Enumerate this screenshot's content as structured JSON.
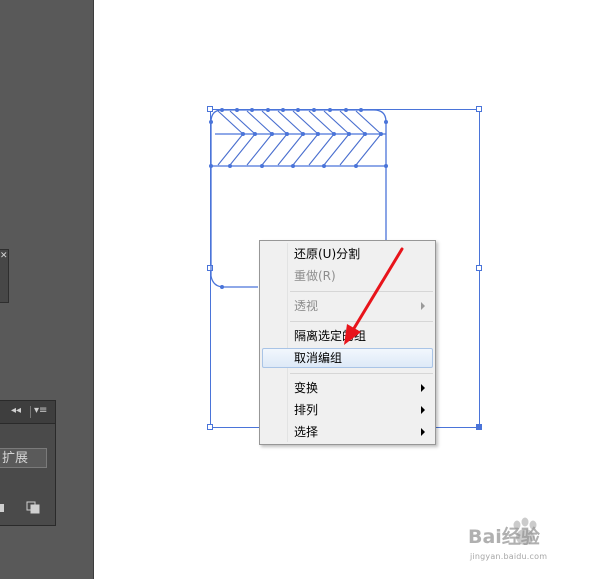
{
  "tool_panel": {
    "expand_button_label": "扩展"
  },
  "context_menu": {
    "items": [
      {
        "label": "还原(U)分割",
        "disabled": false,
        "submenu": false
      },
      {
        "label": "重做(R)",
        "disabled": true,
        "submenu": false
      },
      {
        "label": "透视",
        "disabled": true,
        "submenu": true
      },
      {
        "label": "隔离选定的组",
        "disabled": false,
        "submenu": false
      },
      {
        "label": "取消编组",
        "disabled": false,
        "submenu": false,
        "highlighted": true
      },
      {
        "label": "变换",
        "disabled": false,
        "submenu": true
      },
      {
        "label": "排列",
        "disabled": false,
        "submenu": true
      },
      {
        "label": "选择",
        "disabled": false,
        "submenu": true
      }
    ]
  },
  "watermark": {
    "brand": "Bai经验",
    "url": "jingyan.baidu.com"
  },
  "colors": {
    "selection": "#4a74d9",
    "annotation_arrow": "#e8141b",
    "workspace_dark": "#595959"
  }
}
